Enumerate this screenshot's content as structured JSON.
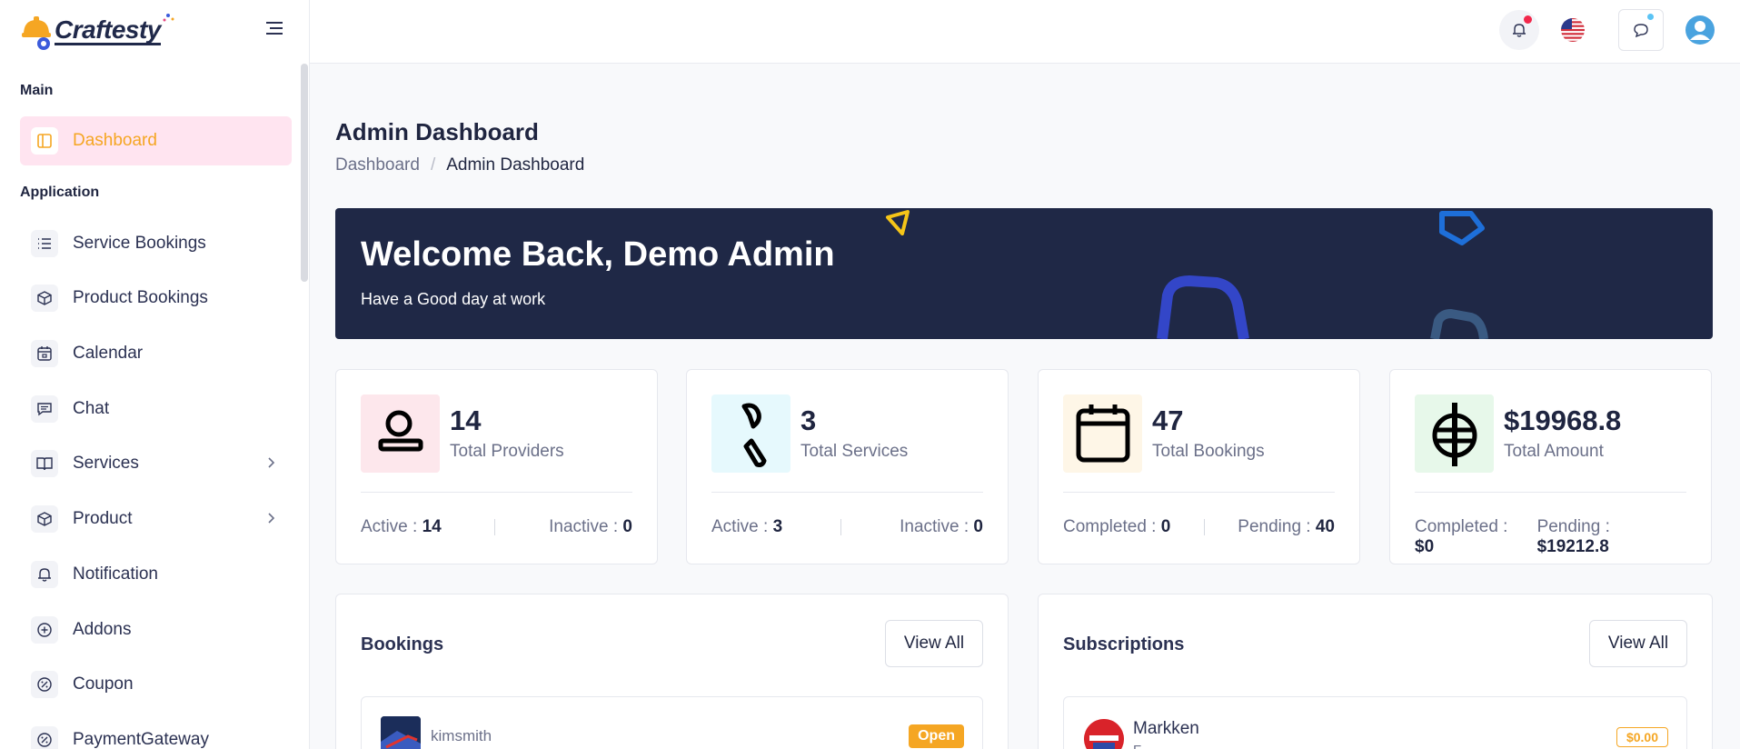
{
  "brand": {
    "name": "Craftesty"
  },
  "sidebar": {
    "sections": {
      "main": "Main",
      "application": "Application"
    },
    "items": [
      {
        "label": "Dashboard",
        "icon": "dashboard-icon"
      },
      {
        "label": "Service Bookings",
        "icon": "list-icon"
      },
      {
        "label": "Product Bookings",
        "icon": "box-icon"
      },
      {
        "label": "Calendar",
        "icon": "calendar-icon"
      },
      {
        "label": "Chat",
        "icon": "chat-icon"
      },
      {
        "label": "Services",
        "icon": "book-icon"
      },
      {
        "label": "Product",
        "icon": "box-icon"
      },
      {
        "label": "Notification",
        "icon": "bell-icon"
      },
      {
        "label": "Addons",
        "icon": "plus-circle-icon"
      },
      {
        "label": "Coupon",
        "icon": "percent-icon"
      },
      {
        "label": "PaymentGateway",
        "icon": "percent-icon"
      }
    ]
  },
  "page": {
    "title": "Admin Dashboard",
    "breadcrumb": {
      "root": "Dashboard",
      "sep": "/",
      "current": "Admin Dashboard"
    }
  },
  "welcome": {
    "title": "Welcome Back, Demo Admin",
    "subtitle": "Have a Good day at work"
  },
  "stats": [
    {
      "value": "14",
      "label": "Total Providers",
      "left_label": "Active : ",
      "left_value": "14",
      "right_label": "Inactive : ",
      "right_value": "0",
      "icon_bg": "#fde7ec"
    },
    {
      "value": "3",
      "label": "Total Services",
      "left_label": "Active : ",
      "left_value": "3",
      "right_label": "Inactive : ",
      "right_value": "0",
      "icon_bg": "#e6f9fd"
    },
    {
      "value": "47",
      "label": "Total Bookings",
      "left_label": "Completed : ",
      "left_value": "0",
      "right_label": "Pending : ",
      "right_value": "40",
      "icon_bg": "#fef6e7"
    },
    {
      "value": "$19968.8",
      "label": "Total Amount",
      "left_label": "Completed : ",
      "left_value": "$0",
      "right_label": "Pending : ",
      "right_value": "$19212.8",
      "icon_bg": "#e7f8ea"
    }
  ],
  "bookings": {
    "title": "Bookings",
    "view_all": "View All",
    "row_name": "kimsmith",
    "status": "Open"
  },
  "subscriptions": {
    "title": "Subscriptions",
    "view_all": "View All",
    "row_name": "Markken",
    "row_sub": "F",
    "price": "$0.00"
  },
  "colors": {
    "accent": "#f5a623",
    "active_bg": "#ffe4f0",
    "banner": "#1f2846"
  }
}
